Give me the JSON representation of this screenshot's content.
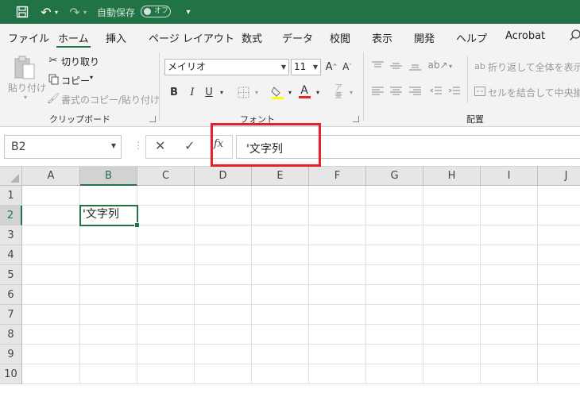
{
  "titlebar": {
    "autosave_label": "自動保存",
    "autosave_toggle": "オフ",
    "color": "#217346"
  },
  "tabs": [
    "ファイル",
    "ホーム",
    "挿入",
    "ページ レイアウト",
    "数式",
    "データ",
    "校閲",
    "表示",
    "開発",
    "ヘルプ",
    "Acrobat"
  ],
  "active_tab": "ホーム",
  "ribbon": {
    "clipboard": {
      "paste": "貼り付け",
      "cut": "切り取り",
      "copy": "コピー",
      "format_painter": "書式のコピー/貼り付け",
      "group_label": "クリップボード"
    },
    "font": {
      "font_name": "メイリオ",
      "font_size": "11",
      "group_label": "フォント"
    },
    "alignment": {
      "wrap_text": "折り返して全体を表示す",
      "merge_center": "セルを結合して中央揃え",
      "group_label": "配置"
    }
  },
  "formula_bar": {
    "name_box": "B2",
    "formula": "'文字列"
  },
  "grid": {
    "columns": [
      "A",
      "B",
      "C",
      "D",
      "E",
      "F",
      "G",
      "H",
      "I",
      "J"
    ],
    "rows": [
      "1",
      "2",
      "3",
      "4",
      "5",
      "6",
      "7",
      "8",
      "9",
      "10"
    ],
    "selected_column": "B",
    "selected_row": "2",
    "active_cell_value": "'文字列"
  }
}
